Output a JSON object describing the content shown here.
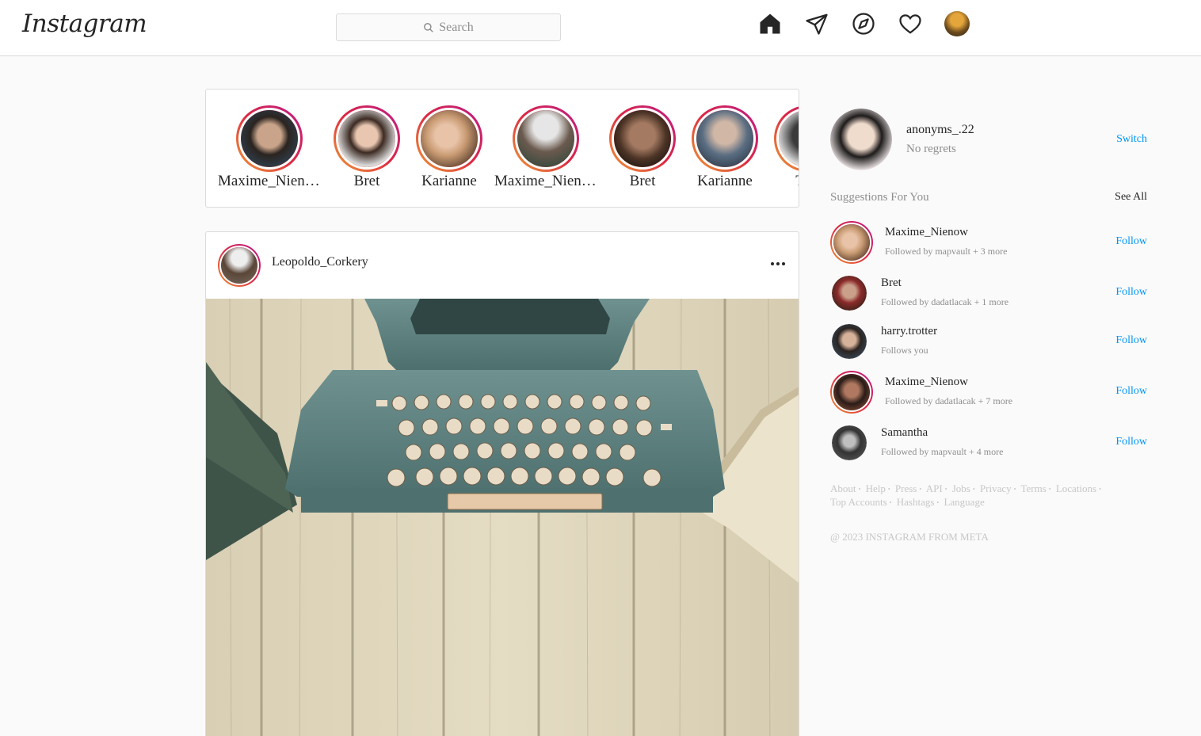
{
  "header": {
    "logo_text": "Instagram",
    "search_placeholder": "Search",
    "icons": [
      "home-icon",
      "direct-message-icon",
      "explore-icon",
      "activity-heart-icon",
      "profile-avatar"
    ]
  },
  "stories": [
    {
      "name": "Maxime_Nienow"
    },
    {
      "name": "Bret"
    },
    {
      "name": "Karianne"
    },
    {
      "name": "Maxime_Nienow"
    },
    {
      "name": "Bret"
    },
    {
      "name": "Karianne"
    },
    {
      "name": "The"
    }
  ],
  "post": {
    "username": "Leopoldo_Corkery",
    "image_alt": "typewriter on wooden table"
  },
  "sidebar": {
    "me": {
      "username": "anonyms_.22",
      "subtitle": "No regrets",
      "switch_label": "Switch"
    },
    "suggestions_title": "Suggestions For You",
    "see_all_label": "See All",
    "suggestions": [
      {
        "name": "Maxime_Nienow",
        "meta": "Followed by mapvault + 3 more",
        "action": "Follow"
      },
      {
        "name": "Bret",
        "meta": "Followed by dadatlacak + 1 more",
        "action": "Follow"
      },
      {
        "name": "harry.trotter",
        "meta": "Follows you",
        "action": "Follow"
      },
      {
        "name": "Maxime_Nienow",
        "meta": "Followed by dadatlacak + 7 more",
        "action": "Follow"
      },
      {
        "name": "Samantha",
        "meta": "Followed by mapvault + 4 more",
        "action": "Follow"
      }
    ],
    "footer_links_line1": [
      "About",
      "Help",
      "Press",
      "API",
      "Jobs",
      "Privacy",
      "Terms",
      "Locations"
    ],
    "footer_links_line2": [
      "Top Accounts",
      "Hashtags",
      "Language"
    ],
    "copyright": "@ 2023 INSTAGRAM FROM META"
  },
  "colors": {
    "link_blue": "#0095f6",
    "border": "#dbdbdb",
    "background": "#fafafa"
  }
}
